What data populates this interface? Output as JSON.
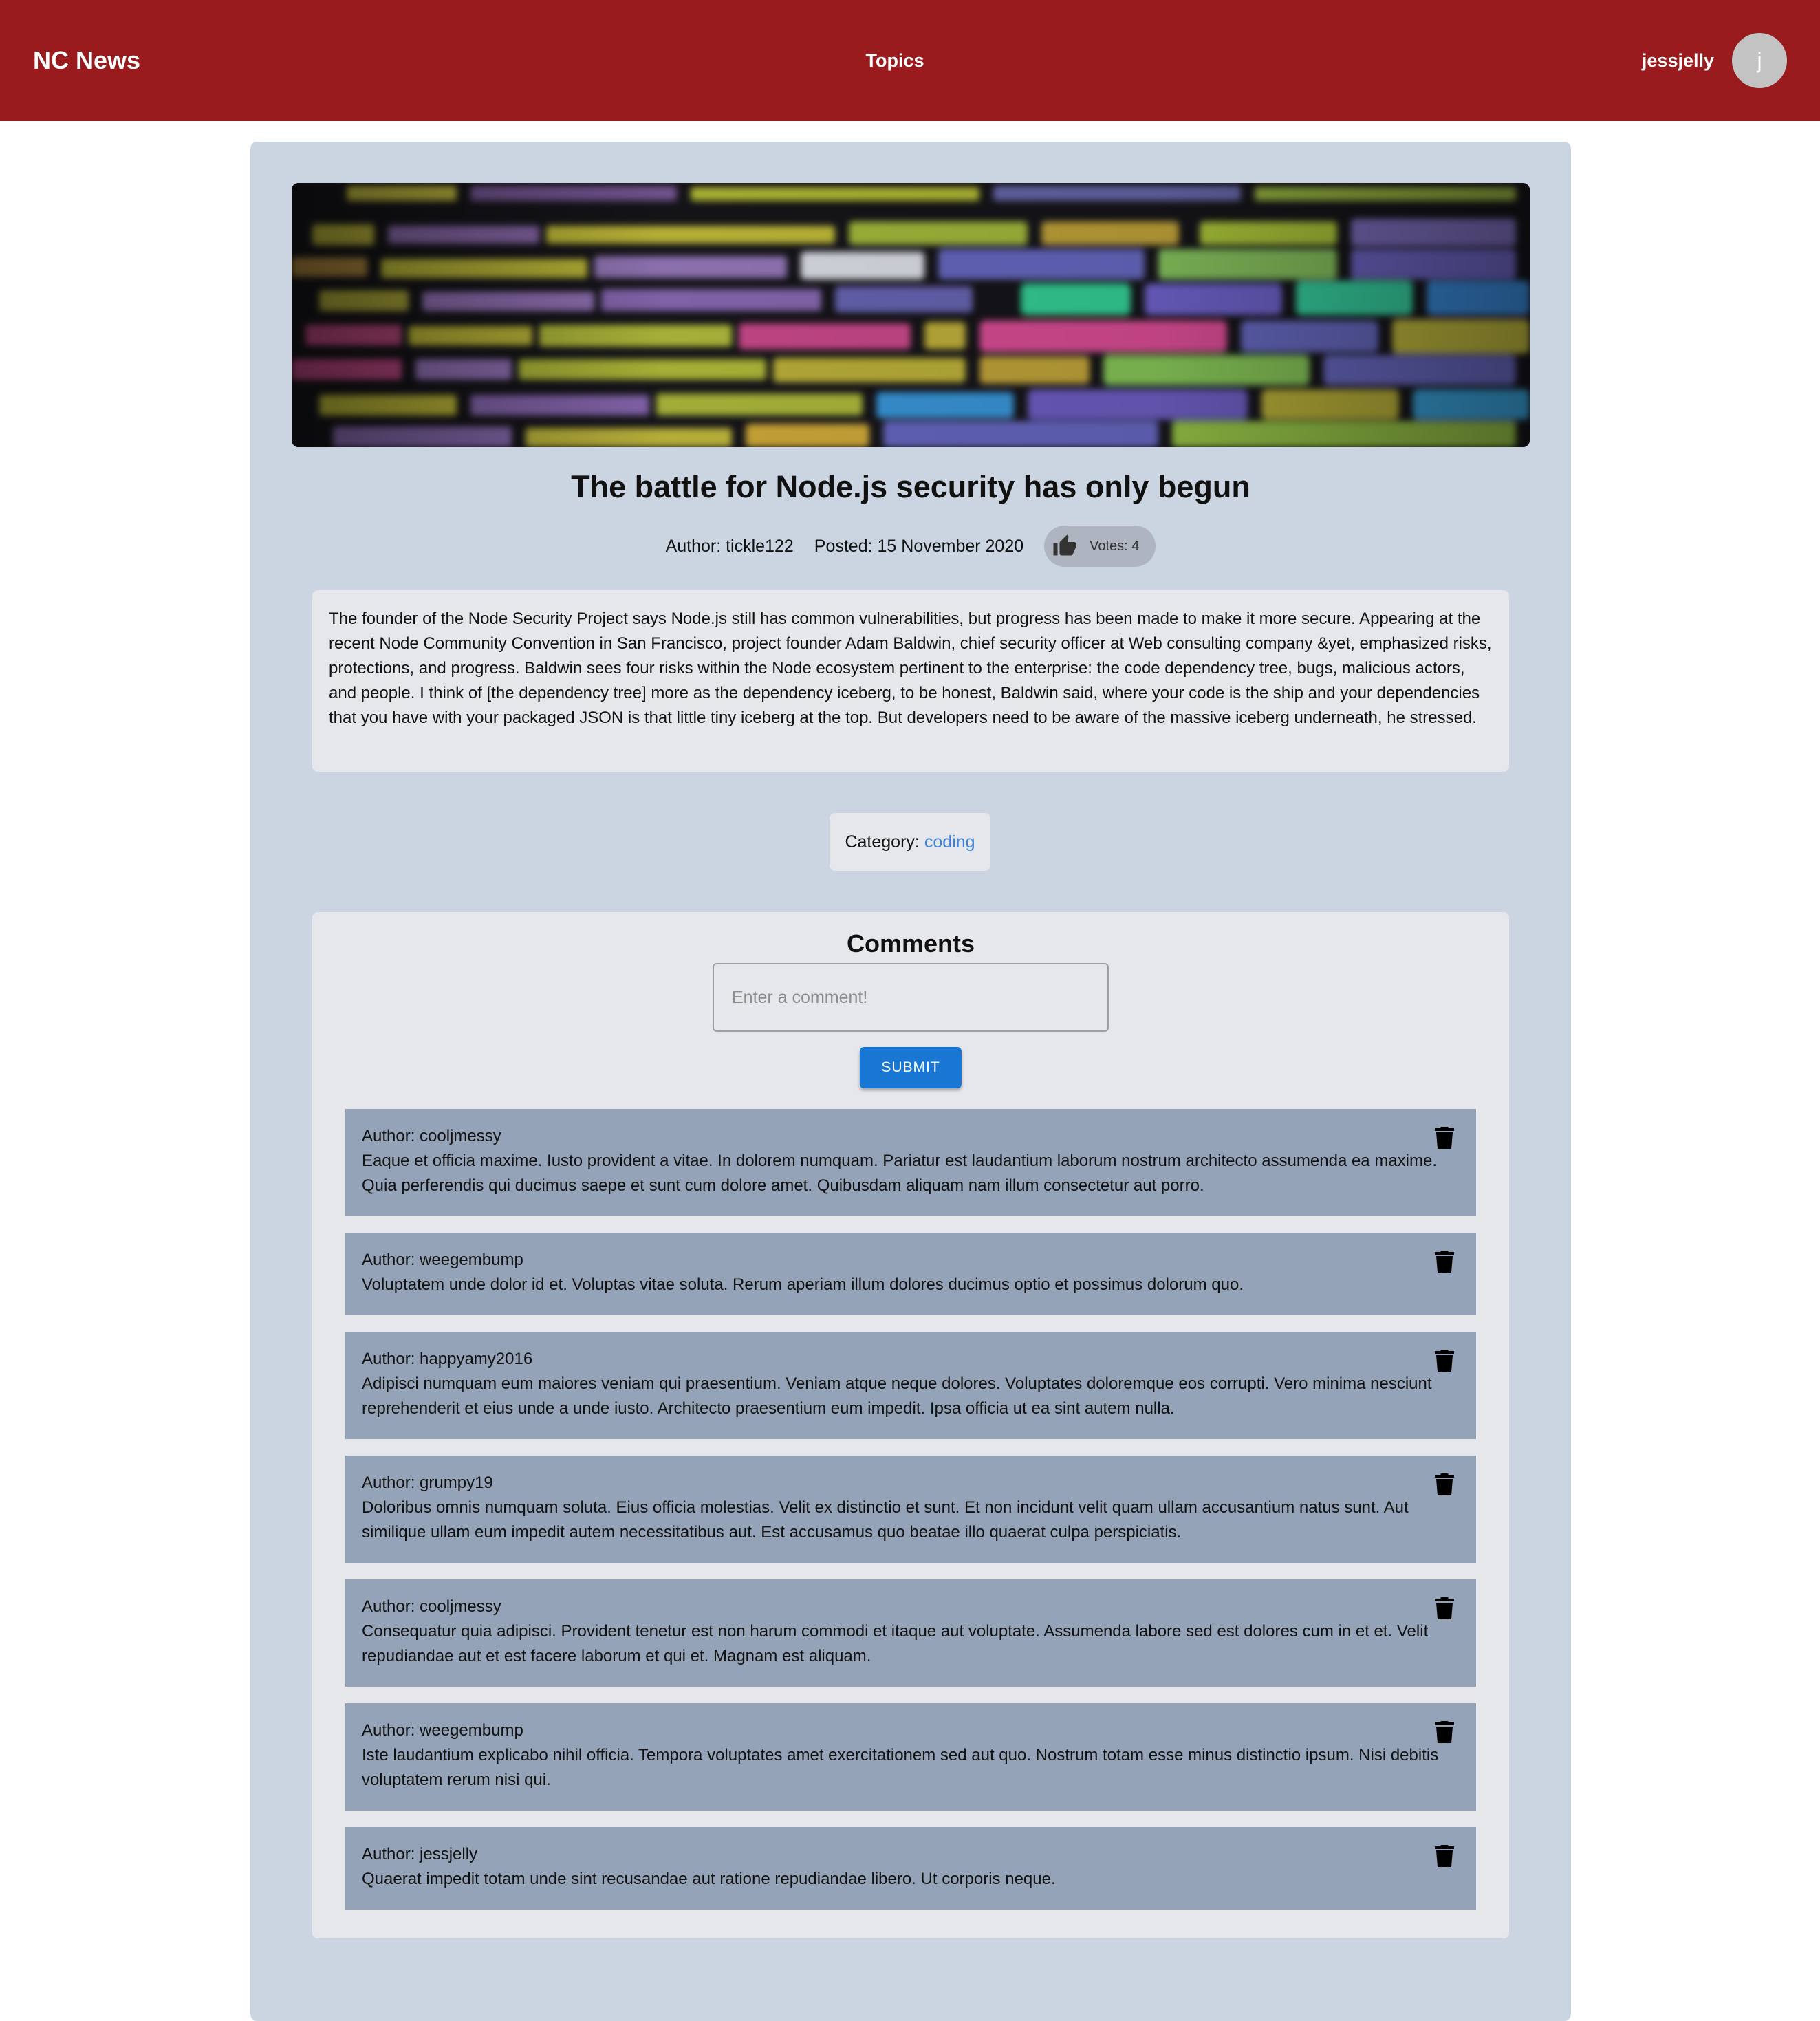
{
  "header": {
    "brand": "NC News",
    "nav_topics": "Topics",
    "username": "jessjelly",
    "avatar_initial": "j"
  },
  "article": {
    "hero_icon": "code-screenshot-image",
    "title": "The battle for Node.js security has only begun",
    "author_line": "Author: tickle122",
    "posted_line": "Posted: 15 November 2020",
    "votes_label": "Votes: 4",
    "vote_icon": "thumb-up-icon",
    "body": "The founder of the Node Security Project says Node.js still has common vulnerabilities, but progress has been made to make it more secure. Appearing at the recent Node Community Convention in San Francisco, project founder Adam Baldwin, chief security officer at Web consulting company &yet, emphasized risks, protections, and progress. Baldwin sees four risks within the Node ecosystem pertinent to the enterprise: the code dependency tree, bugs, malicious actors, and people. I think of [the dependency tree] more as the dependency iceberg, to be honest, Baldwin said, where your code is the ship and your dependencies that you have with your packaged JSON is that little tiny iceberg at the top. But developers need to be aware of the massive iceberg underneath, he stressed.",
    "category_label": "Category:",
    "category_value": "coding"
  },
  "comments": {
    "title": "Comments",
    "input_placeholder": "Enter a comment!",
    "input_value": "",
    "submit_label": "SUBMIT",
    "delete_icon": "trash-icon",
    "items": [
      {
        "author": "Author: cooljmessy",
        "body": "Eaque et officia maxime. Iusto provident a vitae. In dolorem numquam. Pariatur est laudantium laborum nostrum architecto assumenda ea maxime. Quia perferendis qui ducimus saepe et sunt cum dolore amet. Quibusdam aliquam nam illum consectetur aut porro."
      },
      {
        "author": "Author: weegembump",
        "body": "Voluptatem unde dolor id et. Voluptas vitae soluta. Rerum aperiam illum dolores ducimus optio et possimus dolorum quo."
      },
      {
        "author": "Author: happyamy2016",
        "body": "Adipisci numquam eum maiores veniam qui praesentium. Veniam atque neque dolores. Voluptates doloremque eos corrupti. Vero minima nesciunt reprehenderit et eius unde a unde iusto. Architecto praesentium eum impedit. Ipsa officia ut ea sint autem nulla."
      },
      {
        "author": "Author: grumpy19",
        "body": "Doloribus omnis numquam soluta. Eius officia molestias. Velit ex distinctio et sunt. Et non incidunt velit quam ullam accusantium natus sunt. Aut similique ullam eum impedit autem necessitatibus aut. Est accusamus quo beatae illo quaerat culpa perspiciatis."
      },
      {
        "author": "Author: cooljmessy",
        "body": "Consequatur quia adipisci. Provident tenetur est non harum commodi et itaque aut voluptate. Assumenda labore sed est dolores cum in et et. Velit repudiandae aut et est facere laborum et qui et. Magnam est aliquam."
      },
      {
        "author": "Author: weegembump",
        "body": "Iste laudantium explicabo nihil officia. Tempora voluptates amet exercitationem sed aut quo. Nostrum totam esse minus distinctio ipsum. Nisi debitis voluptatem rerum nisi qui."
      },
      {
        "author": "Author: jessjelly",
        "body": "Quaerat impedit totam unde sint recusandae aut ratione repudiandae libero. Ut corporis neque."
      }
    ]
  },
  "colors": {
    "header_bg": "#9a1b1e",
    "card_bg": "#cbd5e1",
    "panel_bg": "#e5e7eb",
    "comment_bg": "#94a3b8",
    "link": "#3b82d8",
    "submit_bg": "#1976d2"
  }
}
